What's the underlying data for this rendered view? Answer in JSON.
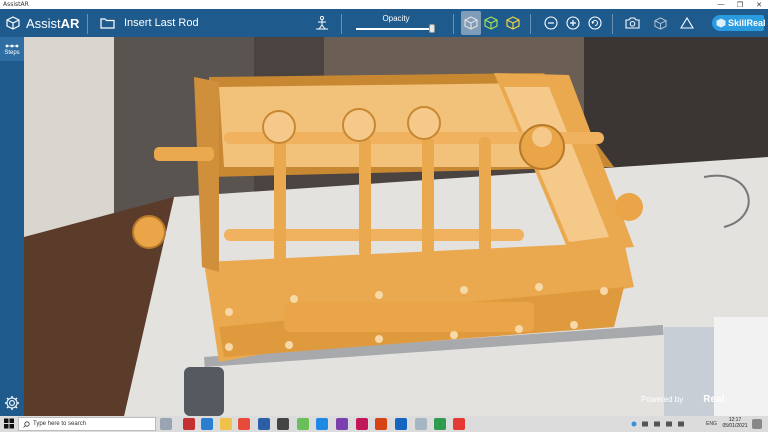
{
  "window": {
    "title": "AssistAR",
    "minimize": "—",
    "maximize": "❐",
    "close": "✕"
  },
  "toolbar": {
    "brand_prefix": "Assist",
    "brand_bold": "AR",
    "task_title": "Insert Last Rod",
    "opacity_label": "Opacity",
    "opacity_value": 0.97,
    "skillreal_label": "SkillReal"
  },
  "sidebar": {
    "steps_label": "Steps"
  },
  "viewport": {
    "powered_by": "Powered by",
    "powered_brand": "Real"
  },
  "taskbar": {
    "search_placeholder": "Type here to search",
    "tray_lang": "ENG",
    "clock_time": "12:17",
    "clock_date": "05/01/2021"
  },
  "colors": {
    "toolbar_bg": "#1f5a8d",
    "model_orange": "#eaa94f",
    "skillreal_blue": "#2b9be0"
  }
}
